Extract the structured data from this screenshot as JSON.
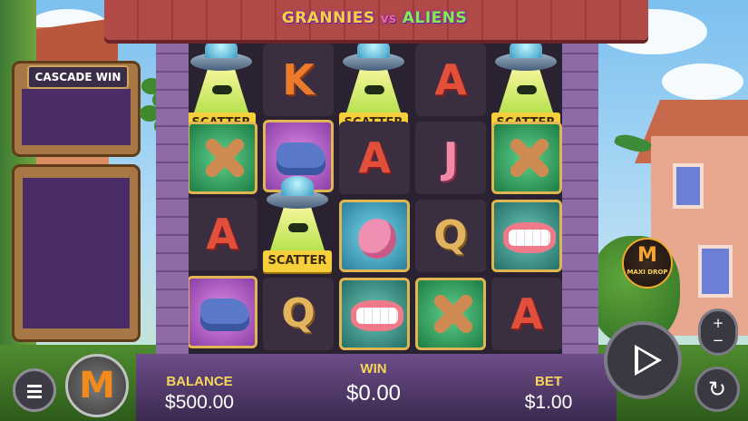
{
  "game": {
    "logo_left": "GRANNIES",
    "logo_vs": "VS",
    "logo_right": "ALIENS"
  },
  "side_panel": {
    "cascade_title": "CASCADE WIN"
  },
  "reels": {
    "columns": [
      [
        "scatter",
        "rolling-pin",
        "letter-A",
        "slipper"
      ],
      [
        "letter-K",
        "slipper",
        "scatter",
        "letter-Q"
      ],
      [
        "scatter",
        "letter-A",
        "purse",
        "dentures"
      ],
      [
        "letter-A",
        "letter-J",
        "letter-Q",
        "rolling-pin"
      ],
      [
        "scatter",
        "rolling-pin",
        "dentures",
        "letter-A"
      ]
    ],
    "scatter_label": "SCATTER",
    "letters": {
      "A": "A",
      "K": "K",
      "J": "J",
      "Q": "Q"
    }
  },
  "hud": {
    "balance_label": "BALANCE",
    "balance_value": "$500.00",
    "win_label": "WIN",
    "win_value": "$0.00",
    "bet_label": "BET",
    "bet_value": "$1.00",
    "bet_plus": "+",
    "bet_minus": "−",
    "logo_letter": "M",
    "badge_letter": "M",
    "badge_text": "MAXI DROP"
  },
  "icons": {
    "menu": "menu-icon",
    "spin": "play-icon",
    "autoplay": "autoplay-icon"
  },
  "colors": {
    "hud_label": "#f7d55b",
    "frame_gold": "#e0b653",
    "reel_bg": "#2a2230",
    "panel_screen": "#4a2c67"
  }
}
